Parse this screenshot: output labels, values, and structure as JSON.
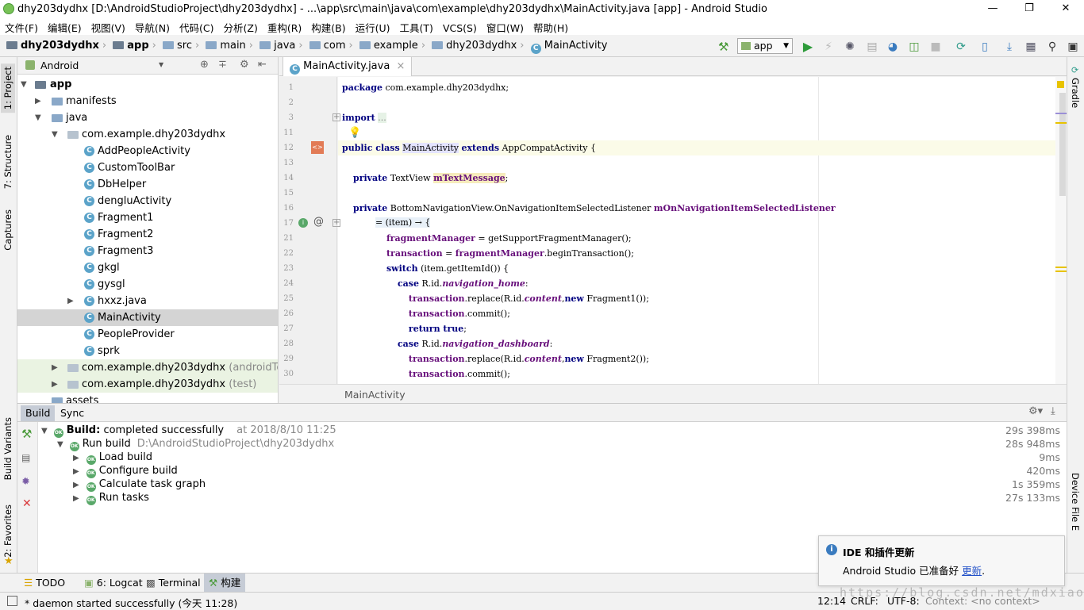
{
  "window": {
    "title": "dhy203dydhx [D:\\AndroidStudioProject\\dhy203dydhx] - ...\\app\\src\\main\\java\\com\\example\\dhy203dydhx\\MainActivity.java [app] - Android Studio"
  },
  "menu": [
    "文件(F)",
    "编辑(E)",
    "视图(V)",
    "导航(N)",
    "代码(C)",
    "分析(Z)",
    "重构(R)",
    "构建(B)",
    "运行(U)",
    "工具(T)",
    "VCS(S)",
    "窗口(W)",
    "帮助(H)"
  ],
  "nav": {
    "crumbs": [
      "dhy203dydhx",
      "app",
      "src",
      "main",
      "java",
      "com",
      "example",
      "dhy203dydhx",
      "MainActivity"
    ],
    "run_config": "app"
  },
  "left_tabs": [
    "1: Project",
    "7: Structure",
    "Captures",
    "Build Variants",
    "2: Favorites"
  ],
  "right_tabs": [
    "Gradle",
    "Device File E"
  ],
  "project": {
    "view": "Android",
    "tree": [
      {
        "label": "app",
        "bold": true
      },
      {
        "label": "manifests"
      },
      {
        "label": "java"
      },
      {
        "label": "com.example.dhy203dydhx"
      },
      {
        "label": "AddPeopleActivity"
      },
      {
        "label": "CustomToolBar"
      },
      {
        "label": "DbHelper"
      },
      {
        "label": "dengluActivity"
      },
      {
        "label": "Fragment1"
      },
      {
        "label": "Fragment2"
      },
      {
        "label": "Fragment3"
      },
      {
        "label": "gkgl"
      },
      {
        "label": "gysgl"
      },
      {
        "label": "hxxz.java"
      },
      {
        "label": "MainActivity"
      },
      {
        "label": "PeopleProvider"
      },
      {
        "label": "sprk"
      },
      {
        "label": "com.example.dhy203dydhx",
        "suffix": "(androidTest)"
      },
      {
        "label": "com.example.dhy203dydhx",
        "suffix": "(test)"
      },
      {
        "label": "assets"
      }
    ]
  },
  "editor": {
    "tab": "MainActivity.java",
    "breadcrumb": "MainActivity",
    "line_numbers": [
      "1",
      "2",
      "3",
      "11",
      "12",
      "13",
      "14",
      "15",
      "16",
      "17",
      "21",
      "22",
      "23",
      "24",
      "25",
      "26",
      "27",
      "28",
      "29",
      "30"
    ]
  },
  "build": {
    "tabs": [
      "Build",
      "Sync"
    ],
    "root_label": "Build:",
    "root_status": "completed successfully",
    "root_time": "at 2018/8/10 11:25",
    "root_dur": "29s 398ms",
    "run_label": "Run build",
    "run_path": "D:\\AndroidStudioProject\\dhy203dydhx",
    "run_dur": "28s 948ms",
    "steps": [
      {
        "label": "Load build",
        "dur": "9ms"
      },
      {
        "label": "Configure build",
        "dur": "420ms"
      },
      {
        "label": "Calculate task graph",
        "dur": "1s 359ms"
      },
      {
        "label": "Run tasks",
        "dur": "27s 133ms"
      }
    ]
  },
  "bottom_tabs": [
    "TODO",
    "6: Logcat",
    "Terminal",
    "构建"
  ],
  "status": {
    "message": "* daemon started successfully (今天 11:28)",
    "pos": "12:14",
    "crlf": "CRLF:",
    "enc": "UTF-8:",
    "context": "Context: <no context>"
  },
  "notification": {
    "title": "IDE 和插件更新",
    "body": "Android Studio 已准备好",
    "link": "更新",
    "tail": "."
  },
  "watermark": "https://blog.csdn.net/mdxiaohu"
}
